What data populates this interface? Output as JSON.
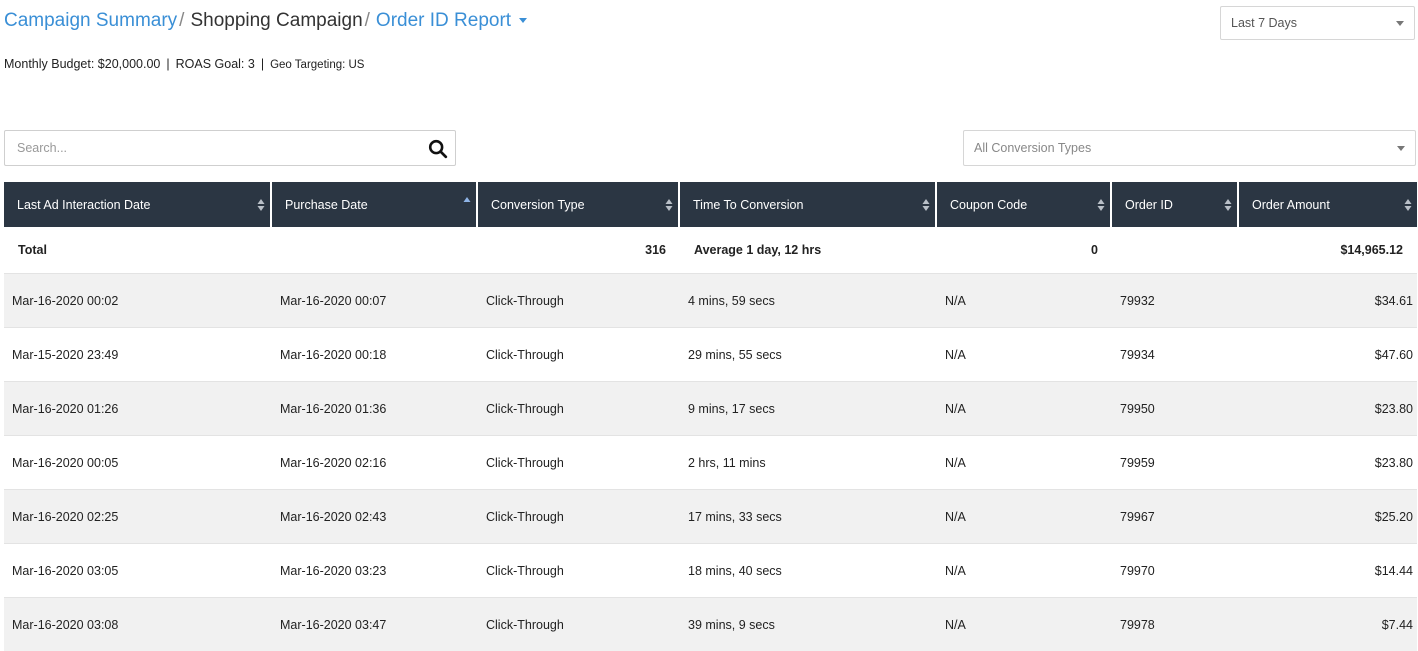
{
  "breadcrumb": {
    "campaign_summary": "Campaign Summary",
    "sep1": "/",
    "shopping_campaign": "Shopping Campaign",
    "sep2": "/",
    "report": "Order ID Report"
  },
  "info": {
    "budget": "Monthly Budget: $20,000.00",
    "roas": "ROAS Goal: 3",
    "geo": "Geo Targeting: US",
    "pipe": "|"
  },
  "date_range": {
    "selected": "Last 7 Days"
  },
  "search": {
    "placeholder": "Search..."
  },
  "conversion_filter": {
    "selected": "All Conversion Types"
  },
  "colors": {
    "header_bg": "#2b3643",
    "link": "#3a8fd6",
    "row_alt": "#f1f1f1"
  },
  "table": {
    "columns": [
      "Last Ad Interaction Date",
      "Purchase Date",
      "Conversion Type",
      "Time To Conversion",
      "Coupon Code",
      "Order ID",
      "Order Amount"
    ],
    "sorted_column": "Purchase Date",
    "sort_direction": "ascending",
    "total": {
      "label": "Total",
      "conversion_count": "316",
      "time_to_conversion": "Average 1 day, 12 hrs",
      "coupon_count": "0",
      "order_amount": "$14,965.12"
    },
    "rows": [
      [
        "Mar-16-2020 00:02",
        "Mar-16-2020 00:07",
        "Click-Through",
        "4 mins, 59 secs",
        "N/A",
        "79932",
        "$34.61"
      ],
      [
        "Mar-15-2020 23:49",
        "Mar-16-2020 00:18",
        "Click-Through",
        "29 mins, 55 secs",
        "N/A",
        "79934",
        "$47.60"
      ],
      [
        "Mar-16-2020 01:26",
        "Mar-16-2020 01:36",
        "Click-Through",
        "9 mins, 17 secs",
        "N/A",
        "79950",
        "$23.80"
      ],
      [
        "Mar-16-2020 00:05",
        "Mar-16-2020 02:16",
        "Click-Through",
        "2 hrs, 11 mins",
        "N/A",
        "79959",
        "$23.80"
      ],
      [
        "Mar-16-2020 02:25",
        "Mar-16-2020 02:43",
        "Click-Through",
        "17 mins, 33 secs",
        "N/A",
        "79967",
        "$25.20"
      ],
      [
        "Mar-16-2020 03:05",
        "Mar-16-2020 03:23",
        "Click-Through",
        "18 mins, 40 secs",
        "N/A",
        "79970",
        "$14.44"
      ],
      [
        "Mar-16-2020 03:08",
        "Mar-16-2020 03:47",
        "Click-Through",
        "39 mins, 9 secs",
        "N/A",
        "79978",
        "$7.44"
      ]
    ]
  }
}
